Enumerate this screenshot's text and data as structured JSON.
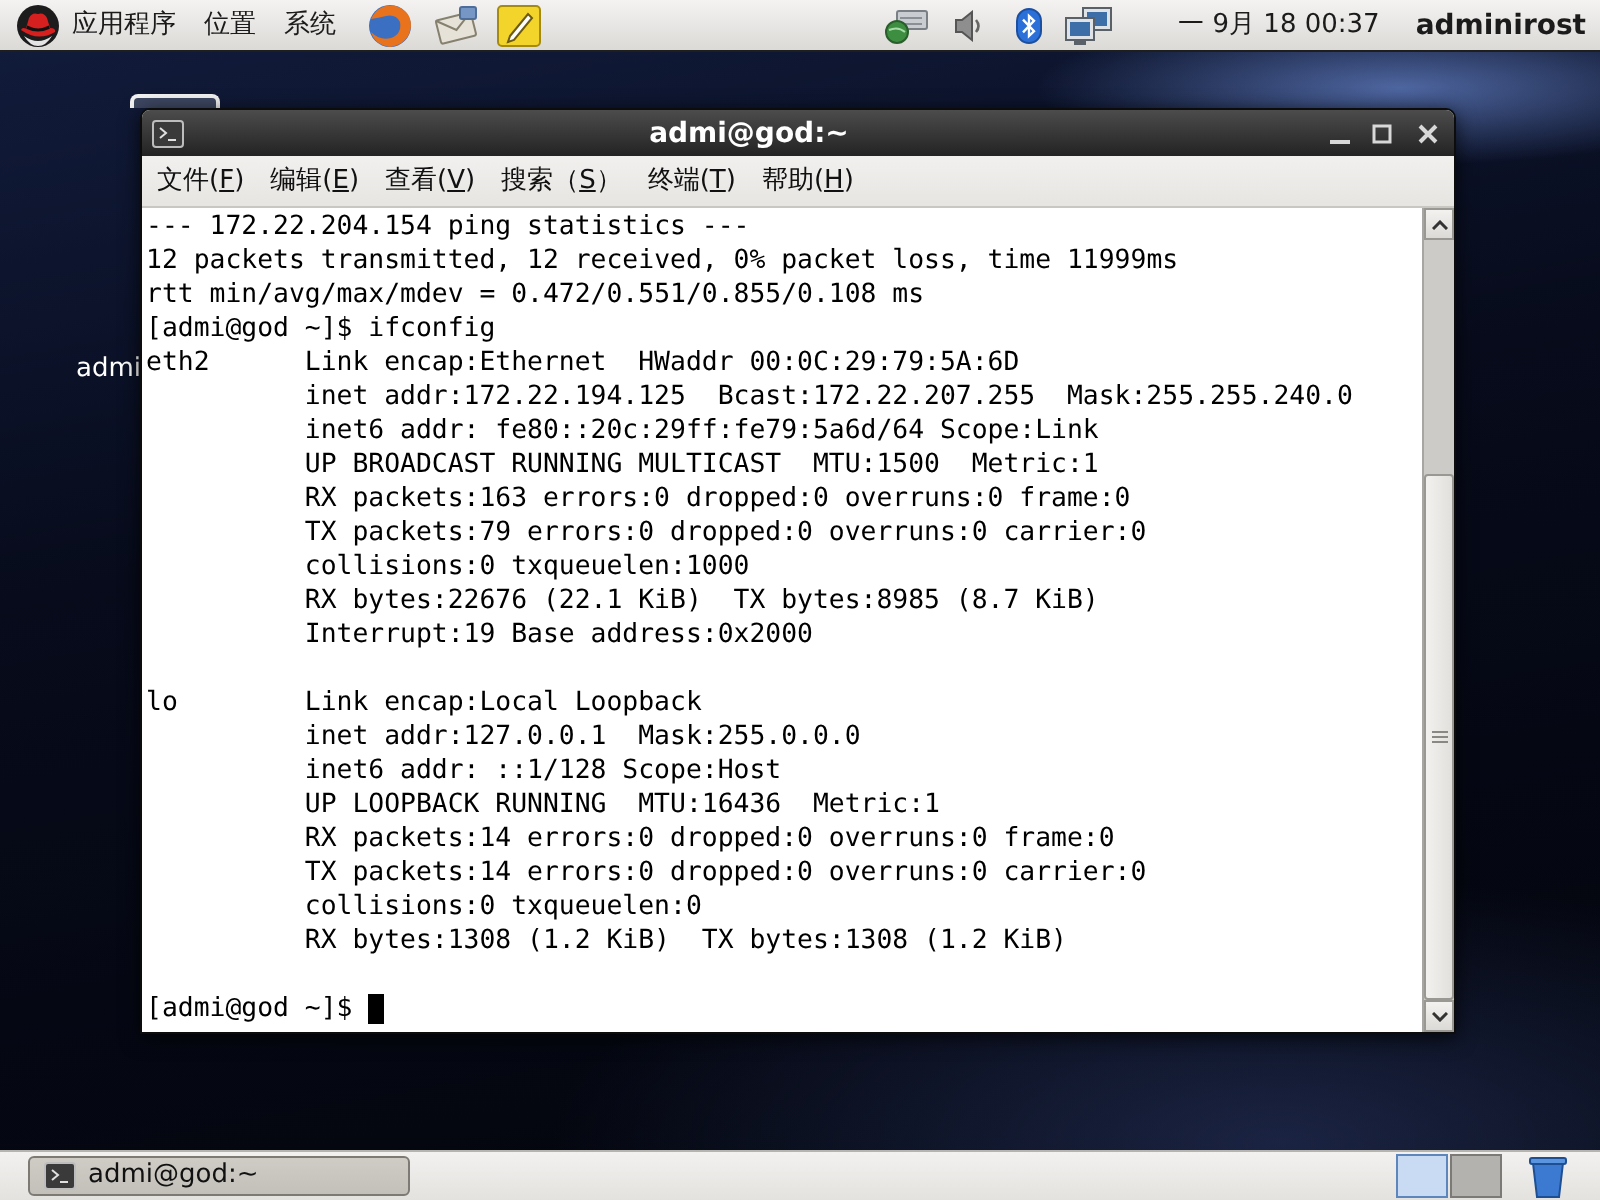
{
  "top_panel": {
    "menus": [
      "应用程序",
      "位置",
      "系统"
    ],
    "clock": "一 9月 18 00:37",
    "user": "adminirost"
  },
  "desktop": {
    "icon_label": "admi"
  },
  "window": {
    "title": "admi@god:~",
    "menu": [
      {
        "text": "文件(",
        "key": "F",
        "tail": ")"
      },
      {
        "text": "编辑(",
        "key": "E",
        "tail": ")"
      },
      {
        "text": "查看(",
        "key": "V",
        "tail": ")"
      },
      {
        "text": "搜索（",
        "key": "S",
        "tail": "）"
      },
      {
        "text": "终端(",
        "key": "T",
        "tail": ")"
      },
      {
        "text": "帮助(",
        "key": "H",
        "tail": ")"
      }
    ],
    "terminal": {
      "lines": [
        "--- 172.22.204.154 ping statistics ---",
        "12 packets transmitted, 12 received, 0% packet loss, time 11999ms",
        "rtt min/avg/max/mdev = 0.472/0.551/0.855/0.108 ms",
        "[admi@god ~]$ ifconfig"
      ],
      "interfaces": [
        {
          "name": "eth2",
          "details": [
            "Link encap:Ethernet  HWaddr 00:0C:29:79:5A:6D",
            "inet addr:172.22.194.125  Bcast:172.22.207.255  Mask:255.255.240.0",
            "inet6 addr: fe80::20c:29ff:fe79:5a6d/64 Scope:Link",
            "UP BROADCAST RUNNING MULTICAST  MTU:1500  Metric:1",
            "RX packets:163 errors:0 dropped:0 overruns:0 frame:0",
            "TX packets:79 errors:0 dropped:0 overruns:0 carrier:0",
            "collisions:0 txqueuelen:1000",
            "RX bytes:22676 (22.1 KiB)  TX bytes:8985 (8.7 KiB)",
            "Interrupt:19 Base address:0x2000"
          ]
        },
        {
          "name": "lo",
          "details": [
            "Link encap:Local Loopback",
            "inet addr:127.0.0.1  Mask:255.0.0.0",
            "inet6 addr: ::1/128 Scope:Host",
            "UP LOOPBACK RUNNING  MTU:16436  Metric:1",
            "RX packets:14 errors:0 dropped:0 overruns:0 frame:0",
            "TX packets:14 errors:0 dropped:0 overruns:0 carrier:0",
            "collisions:0 txqueuelen:0",
            "RX bytes:1308 (1.2 KiB)  TX bytes:1308 (1.2 KiB)"
          ]
        }
      ],
      "prompt": "[admi@god ~]$",
      "cursor": true
    }
  },
  "taskbar": {
    "tasks": [
      {
        "label": "admi@god:~",
        "selected": true
      }
    ],
    "workspaces": [
      {
        "selected": true
      },
      {
        "selected": false
      }
    ]
  }
}
